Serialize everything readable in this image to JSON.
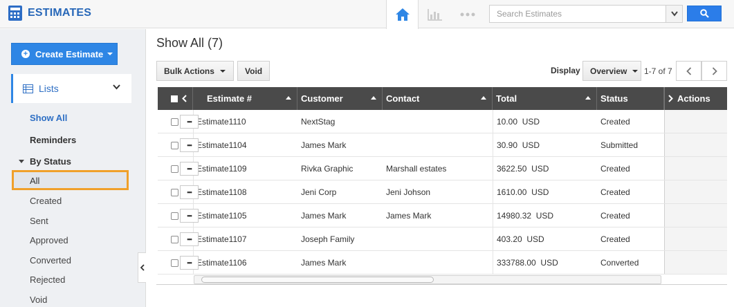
{
  "app": {
    "title": "ESTIMATES"
  },
  "search": {
    "placeholder": "Search Estimates"
  },
  "sidebar": {
    "create_label": "Create Estimate",
    "lists_label": "Lists",
    "items": {
      "show_all": "Show All",
      "reminders": "Reminders",
      "by_status": "By Status",
      "all": "All",
      "created": "Created",
      "sent": "Sent",
      "approved": "Approved",
      "converted": "Converted",
      "rejected": "Rejected",
      "void": "Void"
    }
  },
  "main": {
    "title": "Show All (7)",
    "bulk_actions_label": "Bulk Actions",
    "void_label": "Void",
    "display_label": "Display",
    "display_value": "Overview",
    "pager_text": "1-7 of 7"
  },
  "table": {
    "columns": {
      "estimate": "Estimate #",
      "customer": "Customer",
      "contact": "Contact",
      "total": "Total",
      "status": "Status",
      "actions": "Actions"
    },
    "rows": [
      {
        "estimate": "Estimate1110",
        "customer": "NextStag",
        "contact": "",
        "amount": "10.00",
        "currency": "USD",
        "status": "Created"
      },
      {
        "estimate": "Estimate1104",
        "customer": "James Mark",
        "contact": "",
        "amount": "30.90",
        "currency": "USD",
        "status": "Submitted"
      },
      {
        "estimate": "Estimate1109",
        "customer": "Rivka Graphic",
        "contact": "Marshall estates",
        "amount": "3622.50",
        "currency": "USD",
        "status": "Created"
      },
      {
        "estimate": "Estimate1108",
        "customer": "Jeni Corp",
        "contact": "Jeni Johson",
        "amount": "1610.00",
        "currency": "USD",
        "status": "Created"
      },
      {
        "estimate": "Estimate1105",
        "customer": "James Mark",
        "contact": "James Mark",
        "amount": "14980.32",
        "currency": "USD",
        "status": "Created"
      },
      {
        "estimate": "Estimate1107",
        "customer": "Joseph Family",
        "contact": "",
        "amount": "403.20",
        "currency": "USD",
        "status": "Created"
      },
      {
        "estimate": "Estimate1106",
        "customer": "James Mark",
        "contact": "",
        "amount": "333788.00",
        "currency": "USD",
        "status": "Converted"
      }
    ],
    "action_glyph": "•••"
  },
  "colors": {
    "accent": "#2e86e5",
    "brand_text": "#2767b8",
    "highlight": "#f0a02a",
    "header_bg": "#4a4a4a"
  },
  "icons": [
    "calculator-icon",
    "home-icon",
    "bar-chart-icon",
    "more-dots-icon",
    "dropdown-icon",
    "search-icon",
    "plus-circle-icon",
    "list-icon",
    "chevron-down-icon",
    "chevron-left-icon",
    "chevron-right-icon"
  ]
}
